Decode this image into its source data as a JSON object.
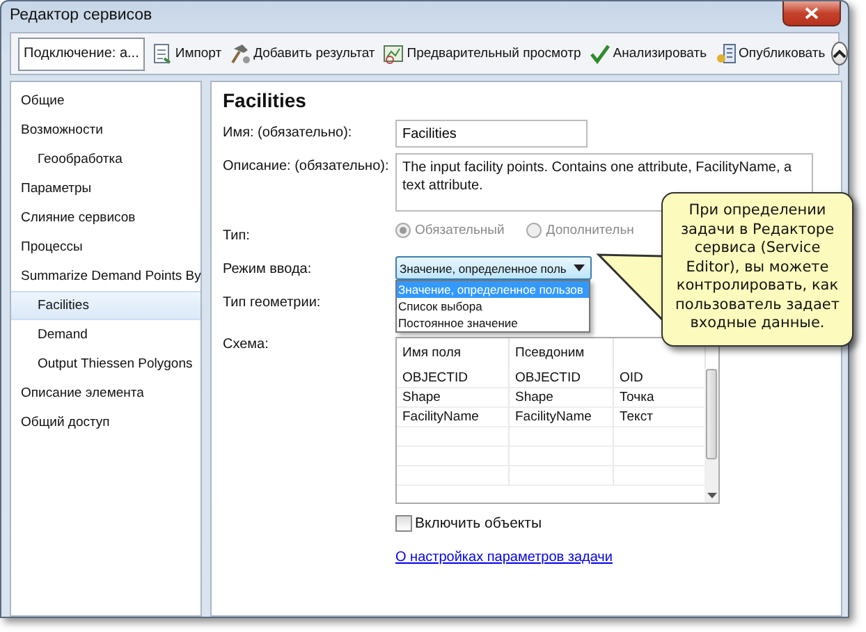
{
  "window": {
    "title": "Редактор сервисов"
  },
  "toolbar": {
    "connection": {
      "value": "Подключение: а..."
    },
    "buttons": [
      {
        "kind": "import",
        "label": "Импорт"
      },
      {
        "kind": "add",
        "label": "Добавить результат"
      },
      {
        "kind": "preview",
        "label": "Предварительный просмотр"
      },
      {
        "kind": "analyze",
        "label": "Анализировать"
      },
      {
        "kind": "publish",
        "label": "Опубликовать"
      }
    ]
  },
  "sidebar": {
    "items": [
      {
        "label": "Общие",
        "selected": false
      },
      {
        "label": "Возможности",
        "selected": false,
        "children": [
          {
            "label": "Геообработка",
            "selected": false
          }
        ]
      },
      {
        "label": "Параметры",
        "selected": false
      },
      {
        "label": "Слияние сервисов",
        "selected": false
      },
      {
        "label": "Процессы",
        "selected": false
      },
      {
        "label": "Summarize Demand Points By",
        "selected": false,
        "children": [
          {
            "label": "Facilities",
            "selected": true
          },
          {
            "label": "Demand",
            "selected": false
          },
          {
            "label": "Output Thiessen Polygons",
            "selected": false
          }
        ]
      },
      {
        "label": "Описание элемента",
        "selected": false
      },
      {
        "label": "Общий доступ",
        "selected": false
      }
    ]
  },
  "panel": {
    "heading": "Facilities",
    "name_field": {
      "label": "Имя: (обязательно):",
      "value": "Facilities"
    },
    "description_field": {
      "label": "Описание: (обязательно):",
      "value": "The input facility points.  Contains one attribute, FacilityName, a text attribute."
    },
    "type": {
      "label": "Тип:",
      "disabled": true,
      "options": [
        {
          "label": "Обязательный",
          "selected": true
        },
        {
          "label": "Дополнительн",
          "selected": false
        }
      ]
    },
    "input_mode": {
      "label": "Режим ввода:",
      "value": "Значение, определенное поль",
      "expanded": true,
      "options": [
        {
          "label": "Значение, определенное пользов",
          "selected": true
        },
        {
          "label": "Список выбора",
          "selected": false
        },
        {
          "label": "Постоянное значение",
          "selected": false
        }
      ]
    },
    "geometry_type": {
      "label": "Тип геометрии:"
    },
    "schema": {
      "label": "Схема:",
      "columns": [
        "Имя поля",
        "Псевдоним"
      ],
      "rows": [
        [
          "OBJECTID",
          "OBJECTID",
          "OID"
        ],
        [
          "Shape",
          "Shape",
          "Точка"
        ],
        [
          "FacilityName",
          "FacilityName",
          "Текст"
        ]
      ]
    },
    "include_features": {
      "label": "Включить объекты",
      "checked": false
    },
    "help_link": {
      "label": "О настройках параметров задачи"
    }
  },
  "callout": {
    "text": "При определении задачи в Редакторе сервиса (Service Editor), вы можете контролировать, как пользователь задает входные данные."
  }
}
